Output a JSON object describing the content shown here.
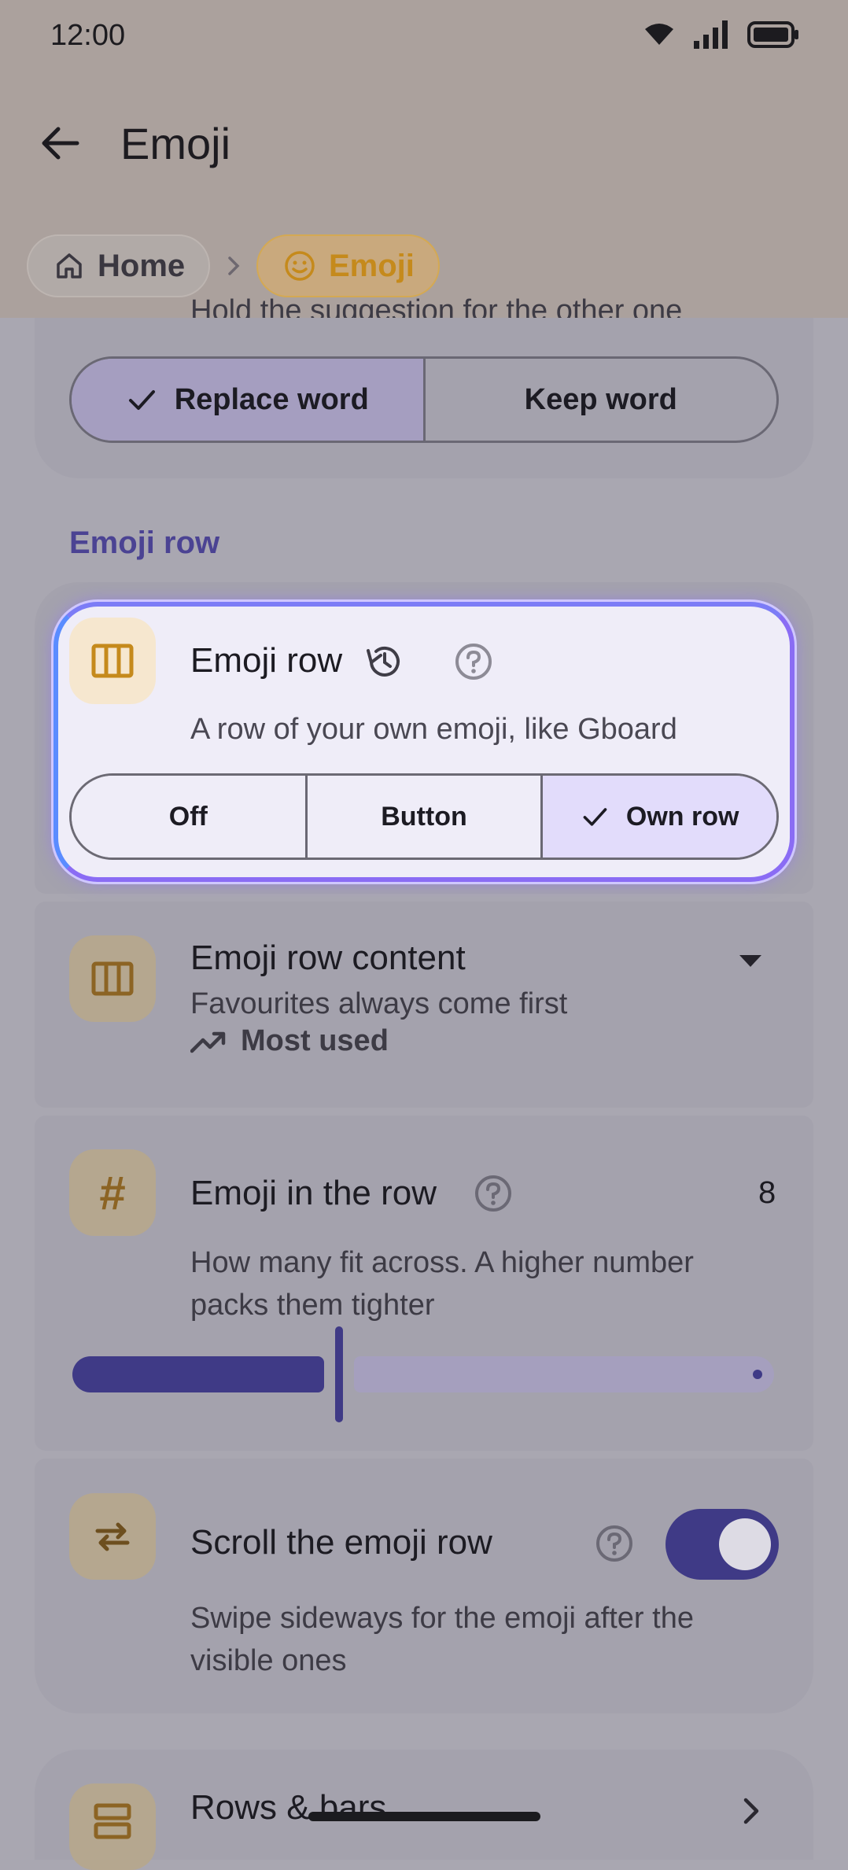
{
  "status_bar": {
    "time": "12:00"
  },
  "header": {
    "title": "Emoji"
  },
  "breadcrumb": {
    "home_label": "Home",
    "current_label": "Emoji"
  },
  "prev_card": {
    "cut_text": "Hold the suggestion for the other one",
    "options": [
      "Replace word",
      "Keep word"
    ],
    "selected": "Replace word"
  },
  "section": {
    "label": "Emoji row"
  },
  "emoji_row_card": {
    "title": "Emoji row",
    "subtitle": "A row of your own emoji, like Gboard",
    "options": [
      "Off",
      "Button",
      "Own row"
    ],
    "selected": "Own row"
  },
  "emoji_row_content": {
    "title": "Emoji row content",
    "subtitle": "Favourites always come first",
    "value": "Most used"
  },
  "emoji_in_row": {
    "title": "Emoji in the row",
    "value": "8",
    "subtitle_line1": "How many fit across. A higher number",
    "subtitle_line2": "packs them tighter",
    "slider_fraction": 0.38
  },
  "scroll_emoji_row": {
    "title": "Scroll the emoji row",
    "subtitle_line1": "Swipe sideways for the emoji after the",
    "subtitle_line2": "visible ones",
    "enabled": true
  },
  "rows_bars": {
    "title": "Rows & bars"
  },
  "colors": {
    "accent": "#3f3a86",
    "brand_amber": "#c58a1c",
    "highlight_border": "#8a6cf4"
  }
}
